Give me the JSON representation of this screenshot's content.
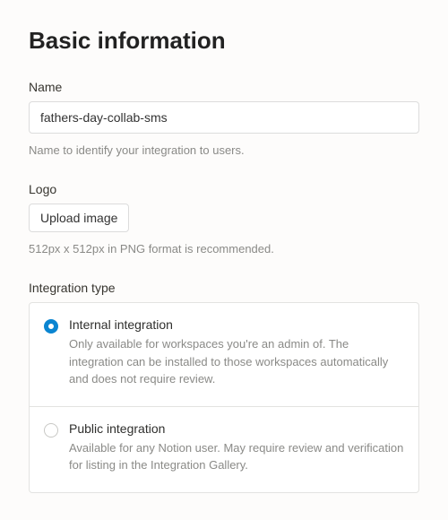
{
  "heading": "Basic information",
  "name": {
    "label": "Name",
    "value": "fathers-day-collab-sms",
    "helper": "Name to identify your integration to users."
  },
  "logo": {
    "label": "Logo",
    "button": "Upload image",
    "helper": "512px x 512px in PNG format is recommended."
  },
  "integration_type": {
    "label": "Integration type",
    "options": [
      {
        "title": "Internal integration",
        "desc": "Only available for workspaces you're an admin of. The integration can be installed to those workspaces automatically and does not require review.",
        "selected": true
      },
      {
        "title": "Public integration",
        "desc": "Available for any Notion user. May require review and verification for listing in the Integration Gallery.",
        "selected": false
      }
    ]
  }
}
